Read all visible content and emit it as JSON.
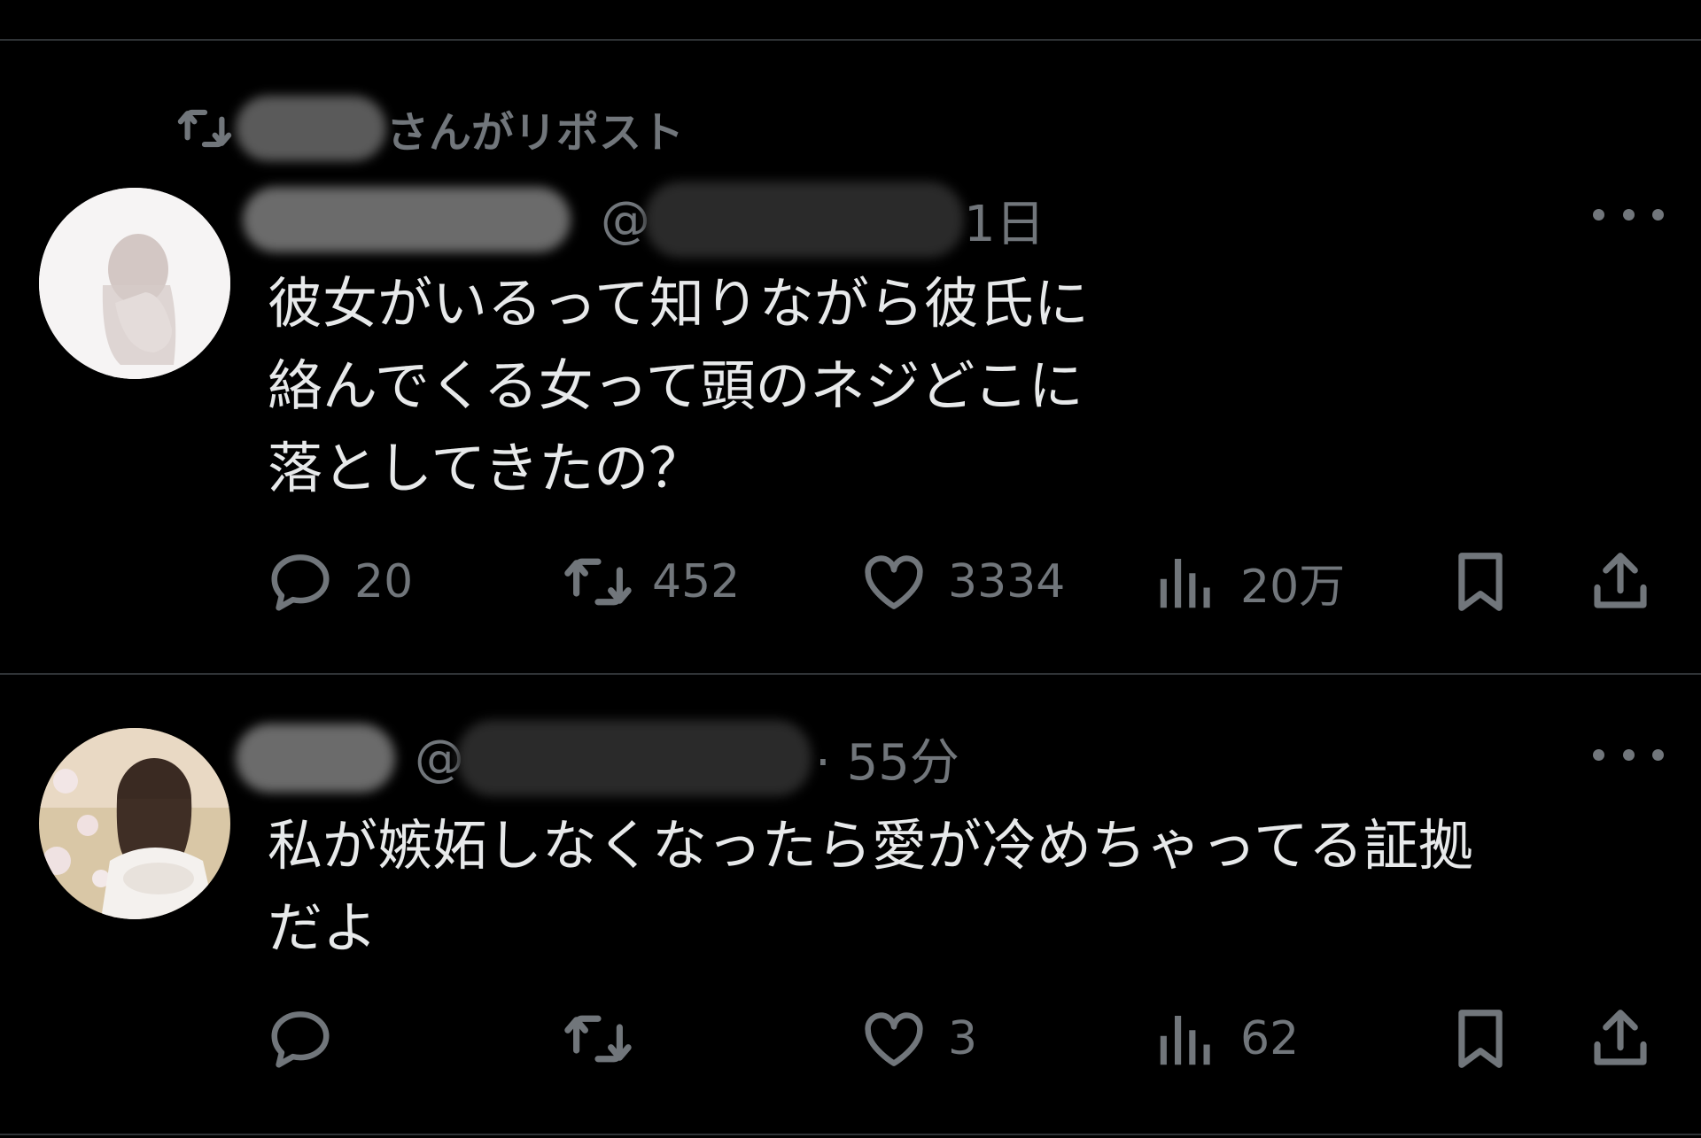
{
  "repost": {
    "suffix": "さんがリポスト"
  },
  "tweets": [
    {
      "handle_prefix": "@",
      "time": "1日",
      "text": "彼女がいるって知りながら彼氏に\n絡んでくる女って頭のネジどこに\n落としてきたの？",
      "replies": "20",
      "reposts": "452",
      "likes": "3334",
      "views": "20万"
    },
    {
      "handle_prefix": "@",
      "time": "· 55分",
      "text": "私が嫉妬しなくなったら愛が冷めちゃってる証拠\nだよ",
      "replies": "",
      "reposts": "",
      "likes": "3",
      "views": "62"
    }
  ],
  "colors": {
    "background": "#000000",
    "text": "#e7e9ea",
    "muted": "#71767b",
    "divider": "#2f3336"
  },
  "icons": [
    "repost-icon",
    "reply-icon",
    "like-icon",
    "views-icon",
    "bookmark-icon",
    "share-icon",
    "more-icon"
  ]
}
